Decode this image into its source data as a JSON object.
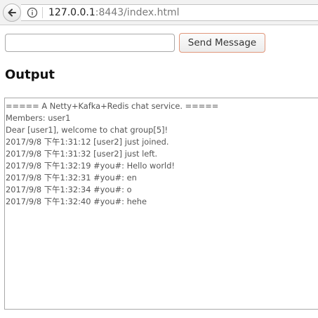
{
  "browser": {
    "url_host": "127.0.0.1",
    "url_rest": ":8443/index.html"
  },
  "chat": {
    "input_value": "",
    "send_label": "Send Message"
  },
  "output": {
    "title": "Output",
    "lines": [
      "===== A Netty+Kafka+Redis chat service. =====",
      "Members: user1",
      "Dear [user1], welcome to chat group[5]!",
      "2017/9/8 下午1:31:12 [user2] just joined.",
      "2017/9/8 下午1:31:32 [user2] just left.",
      "2017/9/8 下午1:32:19 #you#: Hello world!",
      "2017/9/8 下午1:32:31 #you#: en",
      "2017/9/8 下午1:32:34 #you#: o",
      "2017/9/8 下午1:32:40 #you#: hehe"
    ]
  }
}
